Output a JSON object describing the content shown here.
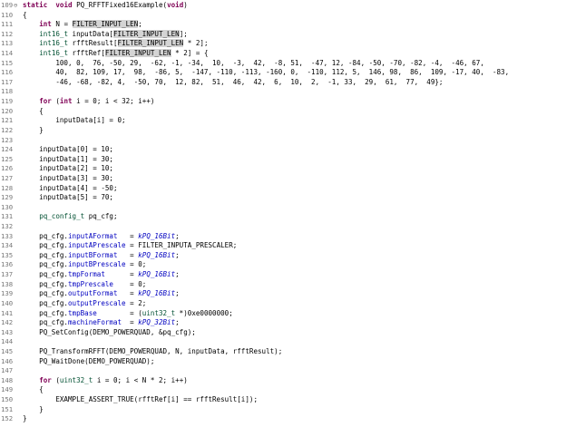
{
  "editor": {
    "lines": [
      {
        "n": "109",
        "fold": "⊖",
        "t": [
          [
            "kw",
            "static"
          ],
          [
            "",
            "  "
          ],
          [
            "kw",
            "void"
          ],
          [
            "",
            " PQ_RFFTFixed16Example("
          ],
          [
            "kw",
            "void"
          ],
          [
            "",
            ")"
          ]
        ]
      },
      {
        "n": "110",
        "t": [
          [
            "",
            "{"
          ]
        ]
      },
      {
        "n": "111",
        "t": [
          [
            "",
            "    "
          ],
          [
            "kw",
            "int"
          ],
          [
            "",
            " N = "
          ],
          [
            "hl",
            "FILTER_INPUT_LEN"
          ],
          [
            "",
            ";"
          ]
        ]
      },
      {
        "n": "112",
        "t": [
          [
            "",
            "    "
          ],
          [
            "ty",
            "int16_t"
          ],
          [
            "",
            " inputData["
          ],
          [
            "hl",
            "FILTER_INPUT_LEN"
          ],
          [
            "",
            "];"
          ]
        ]
      },
      {
        "n": "113",
        "t": [
          [
            "",
            "    "
          ],
          [
            "ty",
            "int16_t"
          ],
          [
            "",
            " rfftResult["
          ],
          [
            "hl",
            "FILTER_INPUT_LEN"
          ],
          [
            "",
            " * 2];"
          ]
        ]
      },
      {
        "n": "114",
        "t": [
          [
            "",
            "    "
          ],
          [
            "ty",
            "int16_t"
          ],
          [
            "",
            " rfftRef["
          ],
          [
            "hl",
            "FILTER_INPUT_LEN"
          ],
          [
            "",
            " * 2] = {"
          ]
        ]
      },
      {
        "n": "115",
        "t": [
          [
            "",
            "        100, 0,  76, -50, 29,  -62, -1, -34,  10,  -3,  42,  -8, 51,  -47, 12, -84, -50, -70, -82, -4,  -46, 67,"
          ]
        ]
      },
      {
        "n": "116",
        "t": [
          [
            "",
            "        40,  82, 109, 17,  98,  -86, 5,  -147, -110, -113, -160, 0,  -110, 112, 5,  146, 98,  86,  109, -17, 40,  -83,"
          ]
        ]
      },
      {
        "n": "117",
        "t": [
          [
            "",
            "        -46, -68, -82, 4,  -50, 70,  12, 82,  51,  46,  42,  6,  10,  2,  -1, 33,  29,  61,  77,  49};"
          ]
        ]
      },
      {
        "n": "118",
        "t": []
      },
      {
        "n": "119",
        "t": [
          [
            "",
            "    "
          ],
          [
            "kw",
            "for"
          ],
          [
            "",
            " ("
          ],
          [
            "kw",
            "int"
          ],
          [
            "",
            " i = 0; i < 32; i++)"
          ]
        ]
      },
      {
        "n": "120",
        "t": [
          [
            "",
            "    {"
          ]
        ]
      },
      {
        "n": "121",
        "t": [
          [
            "",
            "        inputData[i] = 0;"
          ]
        ]
      },
      {
        "n": "122",
        "t": [
          [
            "",
            "    }"
          ]
        ]
      },
      {
        "n": "123",
        "t": []
      },
      {
        "n": "124",
        "t": [
          [
            "",
            "    inputData[0] = 10;"
          ]
        ]
      },
      {
        "n": "125",
        "t": [
          [
            "",
            "    inputData[1] = 30;"
          ]
        ]
      },
      {
        "n": "126",
        "t": [
          [
            "",
            "    inputData[2] = 10;"
          ]
        ]
      },
      {
        "n": "127",
        "t": [
          [
            "",
            "    inputData[3] = 30;"
          ]
        ]
      },
      {
        "n": "128",
        "t": [
          [
            "",
            "    inputData[4] = -50;"
          ]
        ]
      },
      {
        "n": "129",
        "t": [
          [
            "",
            "    inputData[5] = 70;"
          ]
        ]
      },
      {
        "n": "130",
        "t": []
      },
      {
        "n": "131",
        "t": [
          [
            "",
            "    "
          ],
          [
            "ty",
            "pq_config_t"
          ],
          [
            "",
            " pq_cfg;"
          ]
        ]
      },
      {
        "n": "132",
        "t": []
      },
      {
        "n": "133",
        "t": [
          [
            "",
            "    pq_cfg."
          ],
          [
            "fd",
            "inputAFormat"
          ],
          [
            "",
            "   = "
          ],
          [
            "en",
            "kPQ_16Bit"
          ],
          [
            "",
            ";"
          ]
        ]
      },
      {
        "n": "134",
        "t": [
          [
            "",
            "    pq_cfg."
          ],
          [
            "fd",
            "inputAPrescale"
          ],
          [
            "",
            " = FILTER_INPUTA_PRESCALER;"
          ]
        ]
      },
      {
        "n": "135",
        "t": [
          [
            "",
            "    pq_cfg."
          ],
          [
            "fd",
            "inputBFormat"
          ],
          [
            "",
            "   = "
          ],
          [
            "en",
            "kPQ_16Bit"
          ],
          [
            "",
            ";"
          ]
        ]
      },
      {
        "n": "136",
        "t": [
          [
            "",
            "    pq_cfg."
          ],
          [
            "fd",
            "inputBPrescale"
          ],
          [
            "",
            " = 0;"
          ]
        ]
      },
      {
        "n": "137",
        "t": [
          [
            "",
            "    pq_cfg."
          ],
          [
            "fd",
            "tmpFormat"
          ],
          [
            "",
            "      = "
          ],
          [
            "en",
            "kPQ_16Bit"
          ],
          [
            "",
            ";"
          ]
        ]
      },
      {
        "n": "138",
        "t": [
          [
            "",
            "    pq_cfg."
          ],
          [
            "fd",
            "tmpPrescale"
          ],
          [
            "",
            "    = 0;"
          ]
        ]
      },
      {
        "n": "139",
        "t": [
          [
            "",
            "    pq_cfg."
          ],
          [
            "fd",
            "outputFormat"
          ],
          [
            "",
            "   = "
          ],
          [
            "en",
            "kPQ_16Bit"
          ],
          [
            "",
            ";"
          ]
        ]
      },
      {
        "n": "140",
        "t": [
          [
            "",
            "    pq_cfg."
          ],
          [
            "fd",
            "outputPrescale"
          ],
          [
            "",
            " = 2;"
          ]
        ]
      },
      {
        "n": "141",
        "t": [
          [
            "",
            "    pq_cfg."
          ],
          [
            "fd",
            "tmpBase"
          ],
          [
            "",
            "        = ("
          ],
          [
            "ty",
            "uint32_t"
          ],
          [
            "",
            " *)0xe0000000;"
          ]
        ]
      },
      {
        "n": "142",
        "t": [
          [
            "",
            "    pq_cfg."
          ],
          [
            "fd",
            "machineFormat"
          ],
          [
            "",
            "  = "
          ],
          [
            "en",
            "kPQ_32Bit"
          ],
          [
            "",
            ";"
          ]
        ]
      },
      {
        "n": "143",
        "t": [
          [
            "",
            "    PQ_SetConfig(DEMO_POWERQUAD, &pq_cfg);"
          ]
        ]
      },
      {
        "n": "144",
        "t": []
      },
      {
        "n": "145",
        "t": [
          [
            "",
            "    PQ_TransformRFFT(DEMO_POWERQUAD, N, inputData, rfftResult);"
          ]
        ]
      },
      {
        "n": "146",
        "t": [
          [
            "",
            "    PQ_WaitDone(DEMO_POWERQUAD);"
          ]
        ]
      },
      {
        "n": "147",
        "t": []
      },
      {
        "n": "148",
        "t": [
          [
            "",
            "    "
          ],
          [
            "kw",
            "for"
          ],
          [
            "",
            " ("
          ],
          [
            "ty",
            "uint32_t"
          ],
          [
            "",
            " i = 0; i < N * 2; i++)"
          ]
        ]
      },
      {
        "n": "149",
        "t": [
          [
            "",
            "    {"
          ]
        ]
      },
      {
        "n": "150",
        "t": [
          [
            "",
            "        EXAMPLE_ASSERT_TRUE(rfftRef[i] == rfftResult[i]);"
          ]
        ]
      },
      {
        "n": "151",
        "t": [
          [
            "",
            "    }"
          ]
        ]
      },
      {
        "n": "152",
        "t": [
          [
            "",
            "}"
          ]
        ]
      }
    ]
  }
}
